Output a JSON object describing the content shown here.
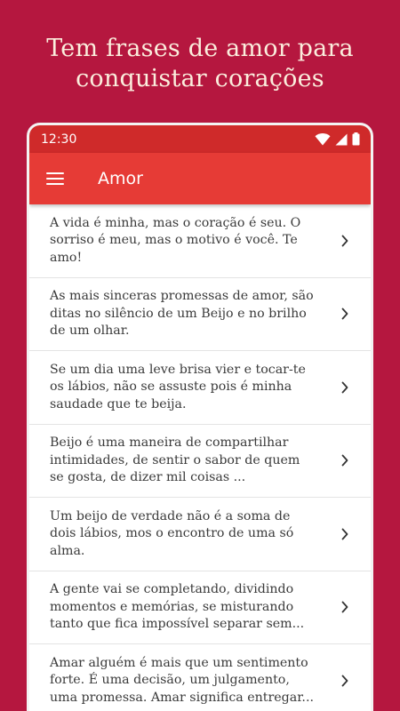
{
  "headline": {
    "line1": "Tem frases de amor para",
    "line2": "conquistar corações"
  },
  "status_bar": {
    "time": "12:30",
    "icons": [
      "wifi-icon",
      "signal-icon",
      "battery-icon"
    ]
  },
  "app_bar": {
    "menu_icon": "menu-icon",
    "title": "Amor"
  },
  "colors": {
    "background": "#b5173f",
    "status_bar": "#cf2a2a",
    "app_bar": "#e63b36",
    "headline_text": "#fbeedd"
  },
  "quotes": [
    {
      "line1": "A vida é minha, mas o coração é seu. O",
      "line2": "sorriso é meu, mas o motivo é você. Te",
      "line3": "amo!"
    },
    {
      "line1": "As mais sinceras promessas de amor, são",
      "line2": "ditas no silêncio de um Beijo e no brilho",
      "line3": "de um olhar."
    },
    {
      "line1": "Se um dia uma leve brisa vier e tocar-te",
      "line2": "os lábios, não se assuste pois é minha",
      "line3": "saudade que te beija."
    },
    {
      "line1": "Beijo é uma maneira de compartilhar",
      "line2": "intimidades, de sentir o sabor de quem",
      "line3": "se gosta, de dizer mil coisas ..."
    },
    {
      "line1": "Um beijo de verdade não é a soma de",
      "line2": "dois lábios, mos o encontro de uma só",
      "line3": "alma."
    },
    {
      "line1": "A gente vai se completando, dividindo",
      "line2": "momentos e memórias, se misturando",
      "line3": "tanto que fica impossível separar sem..."
    },
    {
      "line1": "Amar alguém é mais que um sentimento",
      "line2": "forte. É uma decisão, um julgamento,",
      "line3": "uma promessa. Amar significa entregar..."
    }
  ]
}
